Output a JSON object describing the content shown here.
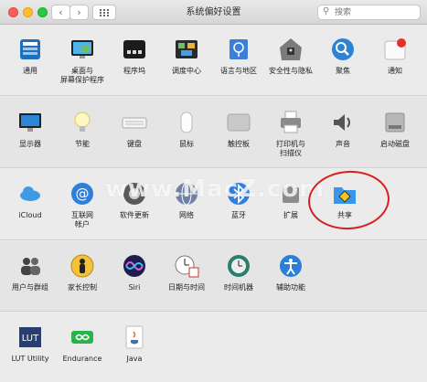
{
  "window": {
    "title": "系统偏好设置"
  },
  "search": {
    "placeholder": "搜索",
    "value": ""
  },
  "toolbar": {
    "back": "‹",
    "forward": "›"
  },
  "rows": [
    [
      {
        "key": "users-contacts",
        "label": "通用",
        "icon": "general-icon"
      },
      {
        "key": "desktop",
        "label": "桌面与\n屏幕保护程序",
        "icon": "desktop-screensaver-icon"
      },
      {
        "key": "dock",
        "label": "程序坞",
        "icon": "dock-icon"
      },
      {
        "key": "mission",
        "label": "调度中心",
        "icon": "mission-control-icon"
      },
      {
        "key": "language",
        "label": "语言与地区",
        "icon": "language-region-icon"
      },
      {
        "key": "security",
        "label": "安全性与隐私",
        "icon": "security-privacy-icon"
      },
      {
        "key": "spotlight",
        "label": "聚焦",
        "icon": "spotlight-icon"
      },
      {
        "key": "notifications",
        "label": "通知",
        "icon": "notifications-icon"
      }
    ],
    [
      {
        "key": "displays",
        "label": "显示器",
        "icon": "displays-icon"
      },
      {
        "key": "energy",
        "label": "节能",
        "icon": "energy-saver-icon"
      },
      {
        "key": "keyboard",
        "label": "键盘",
        "icon": "keyboard-icon"
      },
      {
        "key": "mouse",
        "label": "鼠标",
        "icon": "mouse-icon"
      },
      {
        "key": "trackpad",
        "label": "触控板",
        "icon": "trackpad-icon"
      },
      {
        "key": "printers",
        "label": "打印机与\n扫描仪",
        "icon": "printer-scanner-icon"
      },
      {
        "key": "sound",
        "label": "声音",
        "icon": "sound-icon"
      },
      {
        "key": "startup",
        "label": "启动磁盘",
        "icon": "startup-disk-icon"
      }
    ],
    [
      {
        "key": "icloud",
        "label": "iCloud",
        "icon": "icloud-icon"
      },
      {
        "key": "internet",
        "label": "互联网\n帐户",
        "icon": "internet-accounts-icon"
      },
      {
        "key": "update",
        "label": "软件更新",
        "icon": "software-update-icon"
      },
      {
        "key": "network",
        "label": "网络",
        "icon": "network-icon"
      },
      {
        "key": "bluetooth",
        "label": "蓝牙",
        "icon": "bluetooth-icon"
      },
      {
        "key": "extensions",
        "label": "扩展",
        "icon": "extensions-icon"
      },
      {
        "key": "sharing",
        "label": "共享",
        "icon": "sharing-icon"
      }
    ],
    [
      {
        "key": "users",
        "label": "用户与群组",
        "icon": "users-groups-icon"
      },
      {
        "key": "parental",
        "label": "家长控制",
        "icon": "parental-controls-icon"
      },
      {
        "key": "siri",
        "label": "Siri",
        "icon": "siri-icon"
      },
      {
        "key": "datetime",
        "label": "日期与时间",
        "icon": "date-time-icon"
      },
      {
        "key": "timemachine",
        "label": "时间机器",
        "icon": "time-machine-icon"
      },
      {
        "key": "accessibility",
        "label": "辅助功能",
        "icon": "accessibility-icon"
      }
    ],
    [
      {
        "key": "lut",
        "label": "LUT Utility",
        "icon": "lut-utility-icon"
      },
      {
        "key": "endurance",
        "label": "Endurance",
        "icon": "endurance-icon"
      },
      {
        "key": "java",
        "label": "Java",
        "icon": "java-icon"
      }
    ]
  ],
  "watermark": {
    "text": "www.MacZ.com"
  },
  "colors": {
    "accent": "#1a73e8",
    "highlight_circle": "#d6201f"
  }
}
